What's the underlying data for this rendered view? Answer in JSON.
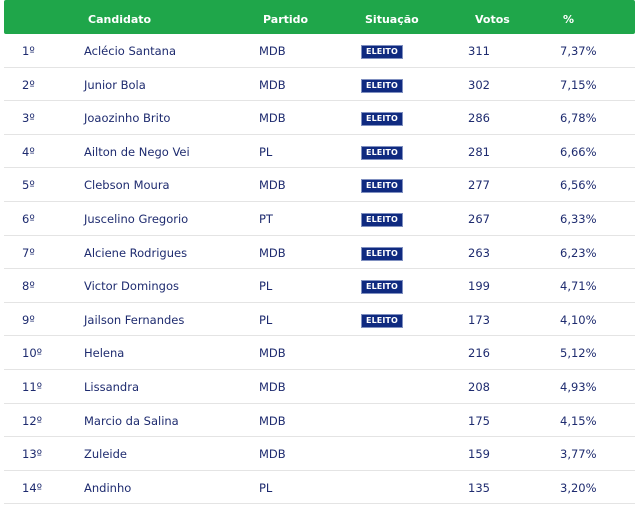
{
  "colors": {
    "header_bg": "#1fa64a",
    "text": "#1e2b6f",
    "badge_bg": "#0f2a80"
  },
  "header": {
    "candidato": "Candidato",
    "partido": "Partido",
    "situacao": "Situação",
    "votos": "Votos",
    "percent": "%"
  },
  "rows": [
    {
      "pos": "1º",
      "name": "Aclécio Santana",
      "party": "MDB",
      "status": "ELEITO",
      "votes": "311",
      "pct": "7,37%"
    },
    {
      "pos": "2º",
      "name": "Junior Bola",
      "party": "MDB",
      "status": "ELEITO",
      "votes": "302",
      "pct": "7,15%"
    },
    {
      "pos": "3º",
      "name": "Joaozinho Brito",
      "party": "MDB",
      "status": "ELEITO",
      "votes": "286",
      "pct": "6,78%"
    },
    {
      "pos": "4º",
      "name": "Ailton de Nego Vei",
      "party": "PL",
      "status": "ELEITO",
      "votes": "281",
      "pct": "6,66%"
    },
    {
      "pos": "5º",
      "name": "Clebson Moura",
      "party": "MDB",
      "status": "ELEITO",
      "votes": "277",
      "pct": "6,56%"
    },
    {
      "pos": "6º",
      "name": "Juscelino Gregorio",
      "party": "PT",
      "status": "ELEITO",
      "votes": "267",
      "pct": "6,33%"
    },
    {
      "pos": "7º",
      "name": "Alciene Rodrigues",
      "party": "MDB",
      "status": "ELEITO",
      "votes": "263",
      "pct": "6,23%"
    },
    {
      "pos": "8º",
      "name": "Victor Domingos",
      "party": "PL",
      "status": "ELEITO",
      "votes": "199",
      "pct": "4,71%"
    },
    {
      "pos": "9º",
      "name": "Jailson Fernandes",
      "party": "PL",
      "status": "ELEITO",
      "votes": "173",
      "pct": "4,10%"
    },
    {
      "pos": "10º",
      "name": "Helena",
      "party": "MDB",
      "status": "",
      "votes": "216",
      "pct": "5,12%"
    },
    {
      "pos": "11º",
      "name": "Lissandra",
      "party": "MDB",
      "status": "",
      "votes": "208",
      "pct": "4,93%"
    },
    {
      "pos": "12º",
      "name": "Marcio da Salina",
      "party": "MDB",
      "status": "",
      "votes": "175",
      "pct": "4,15%"
    },
    {
      "pos": "13º",
      "name": "Zuleide",
      "party": "MDB",
      "status": "",
      "votes": "159",
      "pct": "3,77%"
    },
    {
      "pos": "14º",
      "name": "Andinho",
      "party": "PL",
      "status": "",
      "votes": "135",
      "pct": "3,20%"
    }
  ]
}
